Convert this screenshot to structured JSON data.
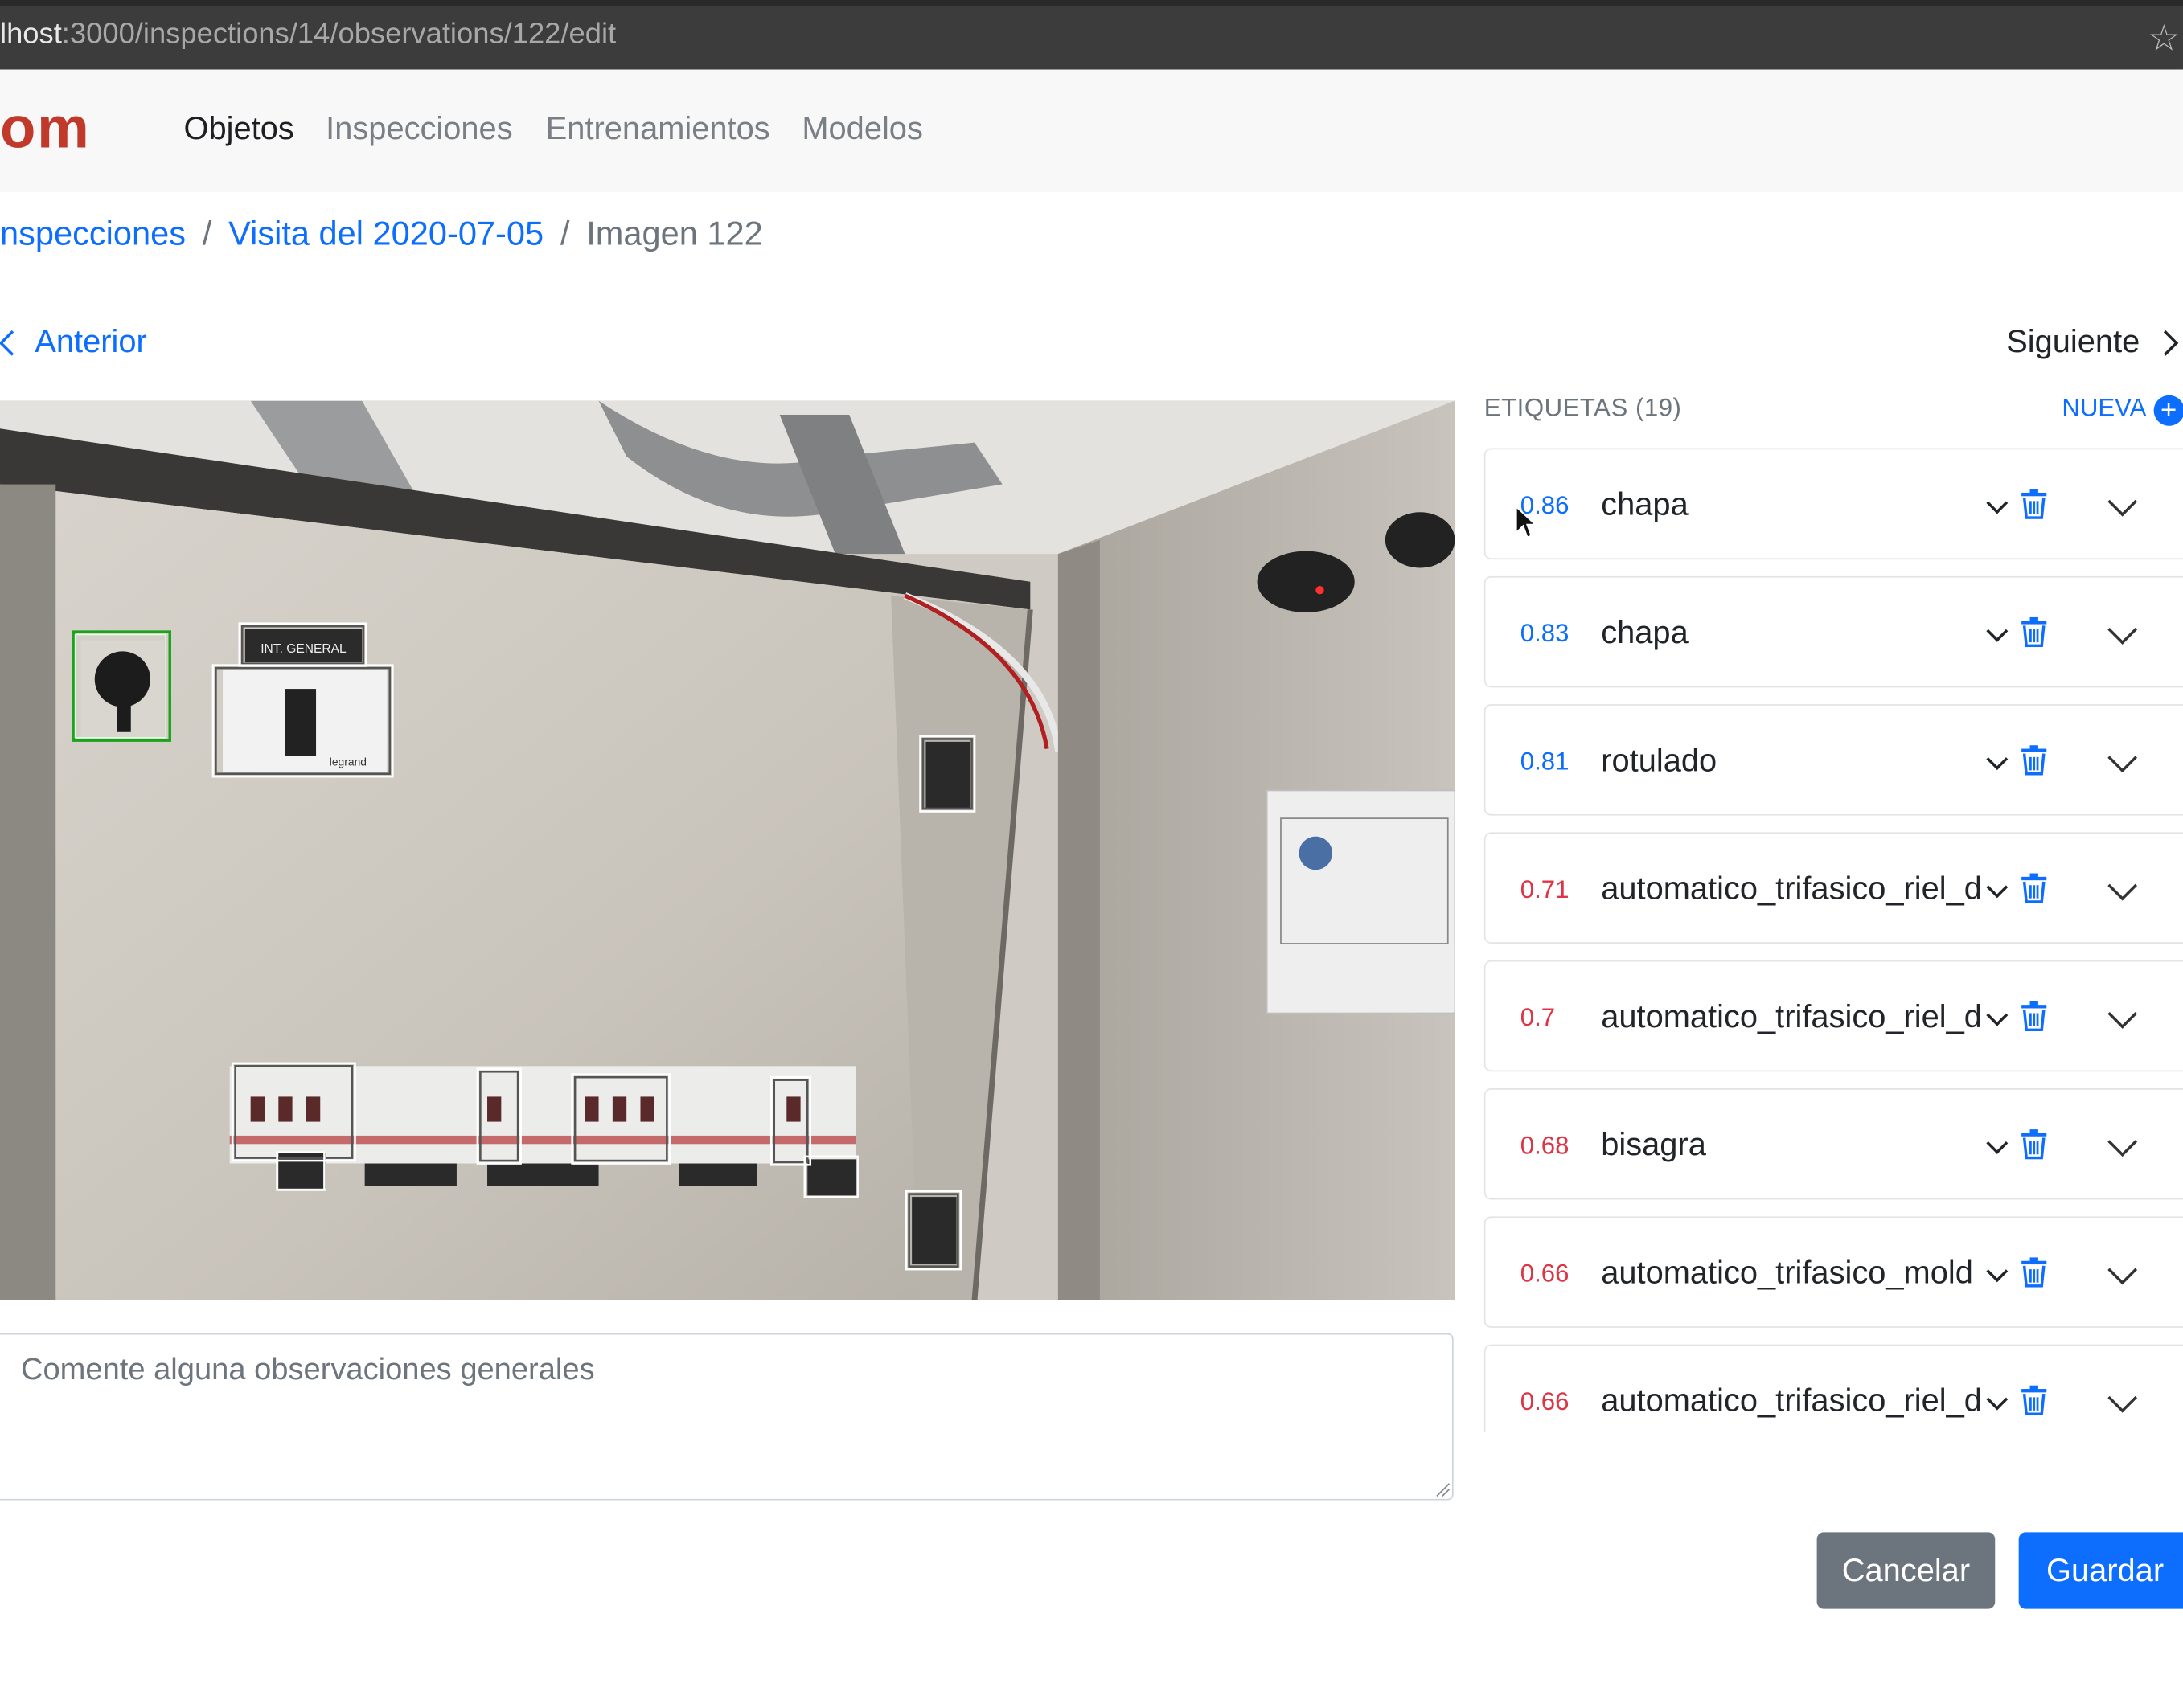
{
  "browser": {
    "url_host": "lhost",
    "url_path": ":3000/inspections/14/observations/122/edit"
  },
  "navbar": {
    "brand": "om",
    "links": [
      {
        "label": "Objetos",
        "active": true
      },
      {
        "label": "Inspecciones",
        "active": false
      },
      {
        "label": "Entrenamientos",
        "active": false
      },
      {
        "label": "Modelos",
        "active": false
      }
    ]
  },
  "breadcrumb": {
    "items": [
      "nspecciones",
      "Visita del 2020-07-05"
    ],
    "current": "Imagen 122",
    "separator": "/"
  },
  "pager": {
    "previous": "Anterior",
    "next": "Siguiente"
  },
  "comments": {
    "placeholder": "Comente alguna observaciones generales",
    "value": ""
  },
  "labels_panel": {
    "title": "ETIQUETAS (19)",
    "new_label": "NUEVA",
    "labels": [
      {
        "score": "0.86",
        "name": "chapa",
        "level": "high"
      },
      {
        "score": "0.83",
        "name": "chapa",
        "level": "high"
      },
      {
        "score": "0.81",
        "name": "rotulado",
        "level": "high"
      },
      {
        "score": "0.71",
        "name": "automatico_trifasico_riel_d",
        "level": "low"
      },
      {
        "score": "0.7",
        "name": "automatico_trifasico_riel_d",
        "level": "low"
      },
      {
        "score": "0.68",
        "name": "bisagra",
        "level": "low"
      },
      {
        "score": "0.66",
        "name": "automatico_trifasico_mold",
        "level": "low"
      },
      {
        "score": "0.66",
        "name": "automatico_trifasico_riel_d",
        "level": "low"
      }
    ]
  },
  "photo_labels": {
    "int_general": "INT. GENERAL",
    "legrand": "legrand"
  },
  "actions": {
    "cancel": "Cancelar",
    "save": "Guardar"
  },
  "colors": {
    "primary": "#0d6efd",
    "danger": "#dc3545",
    "secondary": "#6c757d",
    "brand": "#c0392b",
    "selected_box": "#1aa31a"
  },
  "icons": [
    "star-icon",
    "chevron-left-icon",
    "chevron-right-icon",
    "plus-circle-icon",
    "chevron-down-icon",
    "trash-icon",
    "expand-chevron-icon",
    "cursor-icon"
  ]
}
